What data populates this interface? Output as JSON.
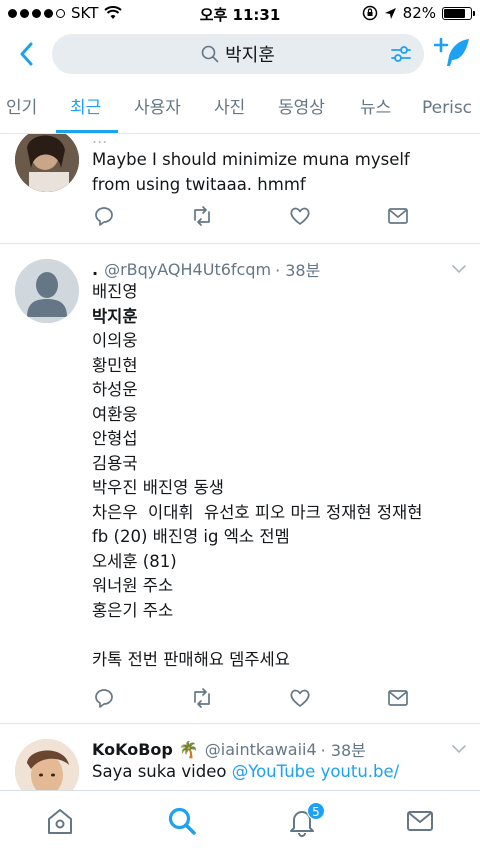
{
  "status_bar": {
    "carrier": "SKT",
    "time": "오후 11:31",
    "battery": "82%",
    "battery_level": 0.82
  },
  "header": {
    "search_query": "박지훈",
    "icons": {
      "back": "chevron-left-icon",
      "search": "search-icon",
      "filter": "sliders-icon",
      "compose": "compose-tweet-icon"
    }
  },
  "tabs": [
    {
      "label": "인기",
      "active": false
    },
    {
      "label": "최근",
      "active": true
    },
    {
      "label": "사용자",
      "active": false
    },
    {
      "label": "사진",
      "active": false
    },
    {
      "label": "동영상",
      "active": false
    },
    {
      "label": "뉴스",
      "active": false
    },
    {
      "label": "Perisc",
      "active": false
    }
  ],
  "tweets": [
    {
      "header_partial": "...",
      "text": "Maybe I should minimize muna myself\nfrom using twitaaa. hmmf"
    },
    {
      "name": ".",
      "handle": "@rBqyAQH4Ut6fcqm",
      "time": "· 38분",
      "lines": [
        {
          "text": "배진영",
          "bold": false
        },
        {
          "text": "박지훈",
          "bold": true
        },
        {
          "text": "이의웅",
          "bold": false
        },
        {
          "text": "황민현",
          "bold": false
        },
        {
          "text": "하성운",
          "bold": false
        },
        {
          "text": "여환웅",
          "bold": false
        },
        {
          "text": "안형섭",
          "bold": false
        },
        {
          "text": "김용국",
          "bold": false
        },
        {
          "text": "박우진 배진영 동생",
          "bold": false
        },
        {
          "text": "차은우  이대휘  유선호 피오 마크 정재현 정재현",
          "bold": false
        },
        {
          "text": "fb (20) 배진영 ig 엑소 전멤",
          "bold": false
        },
        {
          "text": "오세훈 (81)",
          "bold": false
        },
        {
          "text": "워너원 주소",
          "bold": false
        },
        {
          "text": "홍은기 주소",
          "bold": false
        },
        {
          "text": "",
          "bold": false
        },
        {
          "text": "카톡 전번 판매해요 뎀주세요",
          "bold": false
        }
      ]
    },
    {
      "name": "KoKoBop",
      "emoji": "🌴",
      "handle": "@iaintkawaii4",
      "time": "· 38분",
      "text_prefix": "Saya suka video ",
      "link1": "@YouTube",
      "link2": "youtu.be/"
    }
  ],
  "bottom_bar": {
    "items": [
      "home-icon",
      "search-icon",
      "notifications-icon",
      "messages-icon"
    ],
    "notification_badge": "5"
  },
  "colors": {
    "accent": "#1da1f2",
    "text": "#14171a",
    "muted": "#657786",
    "divider": "#e1e8ed",
    "search_bg": "#e6ecf0"
  }
}
